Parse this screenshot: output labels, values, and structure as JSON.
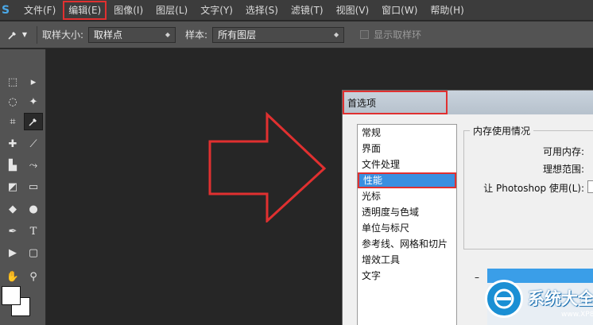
{
  "menubar": {
    "logo_fragment": "S",
    "items": [
      {
        "label": "文件(F)"
      },
      {
        "label": "编辑(E)"
      },
      {
        "label": "图像(I)"
      },
      {
        "label": "图层(L)"
      },
      {
        "label": "文字(Y)"
      },
      {
        "label": "选择(S)"
      },
      {
        "label": "滤镜(T)"
      },
      {
        "label": "视图(V)"
      },
      {
        "label": "窗口(W)"
      },
      {
        "label": "帮助(H)"
      }
    ],
    "highlighted_item": "编辑(E)"
  },
  "options_bar": {
    "tool_icon": "eyedropper-icon",
    "sample_size_label": "取样大小:",
    "sample_size_value": "取样点",
    "sample_label": "样本:",
    "sample_value": "所有图层",
    "show_ring_label": "显示取样环",
    "show_ring_checked": false
  },
  "toolbar": {
    "tools": [
      "marquee-icon",
      "move-icon",
      "lasso-icon",
      "magic-wand-icon",
      "crop-icon",
      "eyedropper-icon",
      "healing-icon",
      "brush-icon",
      "stamp-icon",
      "history-brush-icon",
      "eraser-icon",
      "gradient-icon",
      "blur-icon",
      "dodge-icon",
      "pen-icon",
      "type-icon",
      "path-select-icon",
      "shape-icon",
      "hand-icon",
      "zoom-icon"
    ],
    "selected_tool": "eyedropper-icon"
  },
  "annotation": {
    "arrow_color": "#e03030",
    "highlight_color": "#e03030"
  },
  "dialog": {
    "title": "首选项",
    "categories": [
      {
        "label": "常规"
      },
      {
        "label": "界面"
      },
      {
        "label": "文件处理"
      },
      {
        "label": "性能"
      },
      {
        "label": "光标"
      },
      {
        "label": "透明度与色域"
      },
      {
        "label": "单位与标尺"
      },
      {
        "label": "参考线、网格和切片"
      },
      {
        "label": "增效工具"
      },
      {
        "label": "文字"
      }
    ],
    "selected_category": "性能",
    "memory_group": {
      "legend": "内存使用情况",
      "available_label": "可用内存:",
      "ideal_range_label": "理想范围:",
      "let_photoshop_use_label": "让 Photoshop 使用(L):"
    },
    "dash": "–"
  },
  "watermark": {
    "text": "系统大全",
    "sub": "www.XP85.com"
  }
}
